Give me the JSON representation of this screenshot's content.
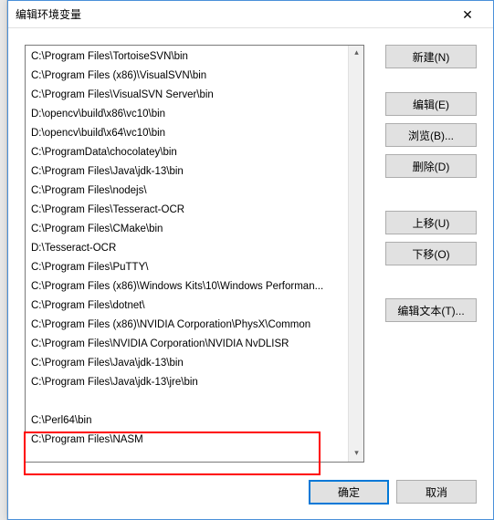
{
  "window": {
    "title": "编辑环境变量",
    "close_icon": "✕"
  },
  "list": {
    "items": [
      "C:\\Program Files\\TortoiseSVN\\bin",
      "C:\\Program Files (x86)\\VisualSVN\\bin",
      "C:\\Program Files\\VisualSVN Server\\bin",
      "D:\\opencv\\build\\x86\\vc10\\bin",
      "D:\\opencv\\build\\x64\\vc10\\bin",
      "C:\\ProgramData\\chocolatey\\bin",
      "C:\\Program Files\\Java\\jdk-13\\bin",
      "C:\\Program Files\\nodejs\\",
      "C:\\Program Files\\Tesseract-OCR",
      "C:\\Program Files\\CMake\\bin",
      "D:\\Tesseract-OCR",
      "C:\\Program Files\\PuTTY\\",
      "C:\\Program Files (x86)\\Windows Kits\\10\\Windows Performan...",
      "C:\\Program Files\\dotnet\\",
      "C:\\Program Files (x86)\\NVIDIA Corporation\\PhysX\\Common",
      "C:\\Program Files\\NVIDIA Corporation\\NVIDIA NvDLISR",
      "C:\\Program Files\\Java\\jdk-13\\bin",
      "C:\\Program Files\\Java\\jdk-13\\jre\\bin",
      "",
      "C:\\Perl64\\bin",
      "C:\\Program Files\\NASM"
    ]
  },
  "buttons": {
    "new": "新建(N)",
    "edit": "编辑(E)",
    "browse": "浏览(B)...",
    "delete": "删除(D)",
    "move_up": "上移(U)",
    "move_down": "下移(O)",
    "edit_text": "编辑文本(T)...",
    "ok": "确定",
    "cancel": "取消"
  },
  "scroll": {
    "up": "▴",
    "down": "▾"
  }
}
